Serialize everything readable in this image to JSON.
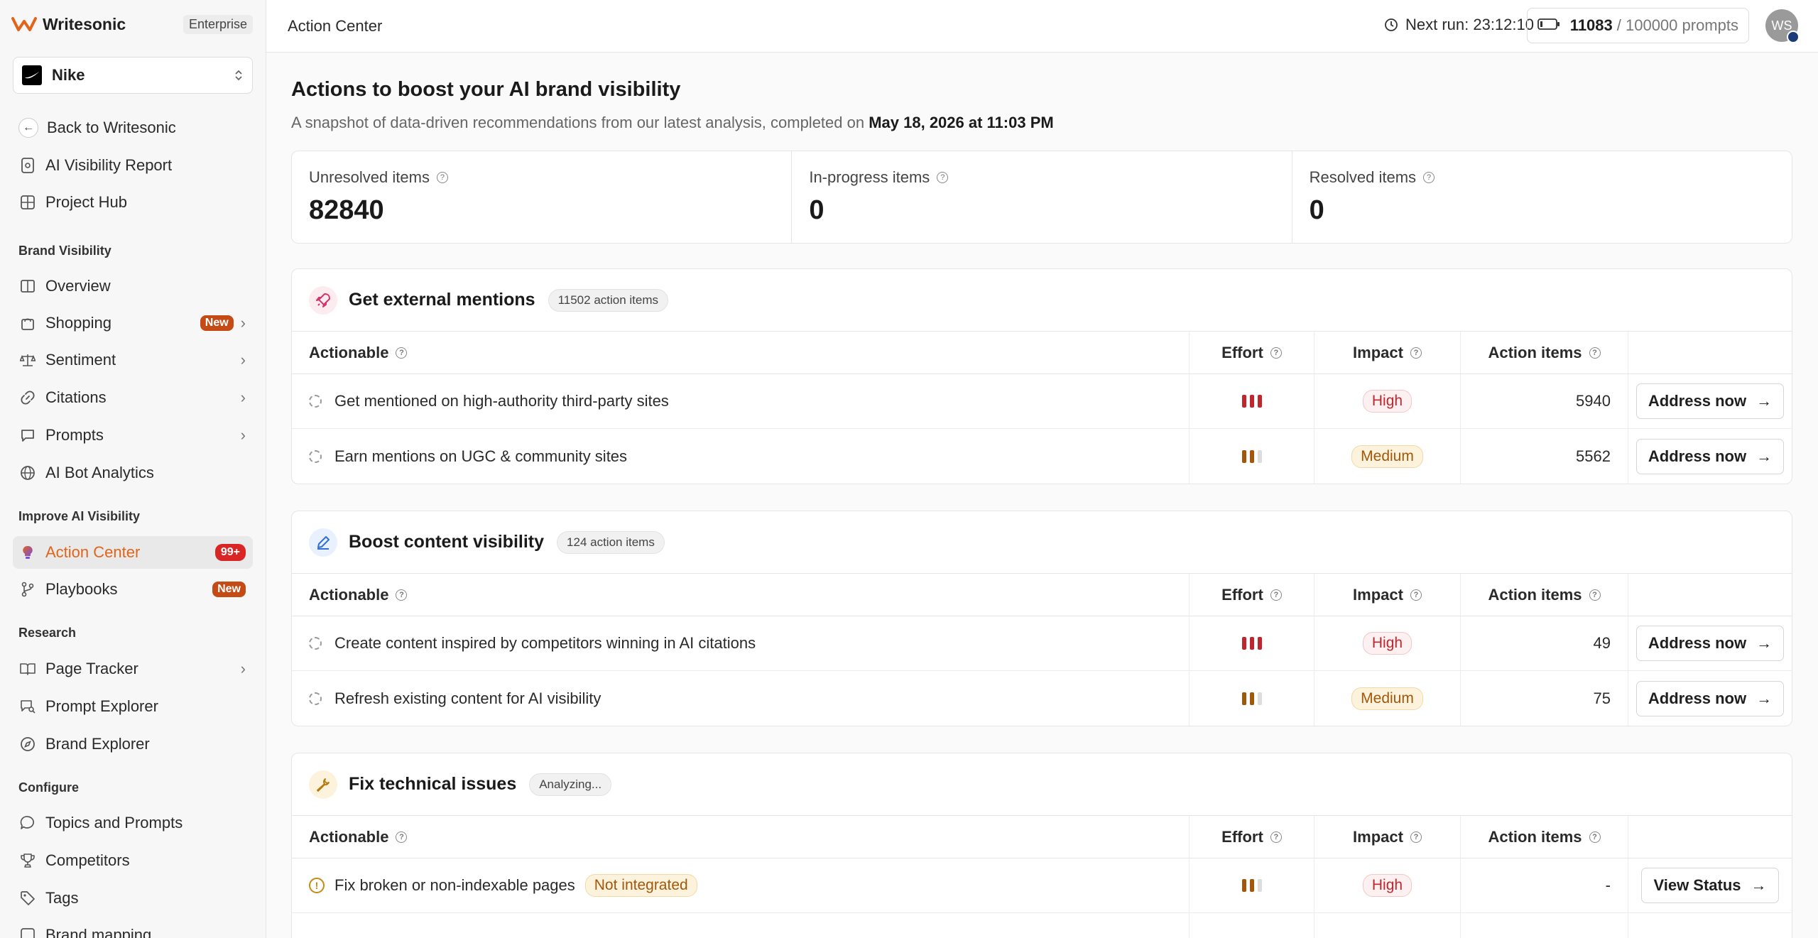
{
  "app": {
    "name": "Writesonic",
    "plan": "Enterprise"
  },
  "project": {
    "name": "Nike"
  },
  "sidebar": {
    "back": "Back to Writesonic",
    "top_items": [
      {
        "label": "AI Visibility Report",
        "icon": "report-icon"
      },
      {
        "label": "Project Hub",
        "icon": "grid-icon"
      }
    ],
    "sections": {
      "brand_visibility": "Brand Visibility",
      "improve": "Improve AI Visibility",
      "research": "Research",
      "configure": "Configure"
    },
    "brand_items": [
      {
        "label": "Overview"
      },
      {
        "label": "Shopping",
        "badge": "New"
      },
      {
        "label": "Sentiment"
      },
      {
        "label": "Citations"
      },
      {
        "label": "Prompts"
      },
      {
        "label": "AI Bot Analytics"
      }
    ],
    "improve_items": [
      {
        "label": "Action Center",
        "badge": "99+"
      },
      {
        "label": "Playbooks",
        "badge": "New"
      }
    ],
    "research_items": [
      {
        "label": "Page Tracker"
      },
      {
        "label": "Prompt Explorer"
      },
      {
        "label": "Brand Explorer"
      }
    ],
    "configure_items": [
      {
        "label": "Topics and Prompts"
      },
      {
        "label": "Competitors"
      },
      {
        "label": "Tags"
      },
      {
        "label": "Brand mapping"
      }
    ]
  },
  "topbar": {
    "breadcrumb": "Action Center",
    "next_run": "Next run: 23:12:10",
    "prompts_used": "11083",
    "prompts_total": "/ 100000 prompts",
    "avatar_initials": "WS"
  },
  "page": {
    "title": "Actions to boost your AI brand visibility",
    "subtitle": "A snapshot of data-driven recommendations from our latest analysis, completed on",
    "completed_on": "May 18, 2026 at 11:03 PM"
  },
  "stats": [
    {
      "label": "Unresolved items",
      "value": "82840"
    },
    {
      "label": "In-progress items",
      "value": "0"
    },
    {
      "label": "Resolved items",
      "value": "0"
    }
  ],
  "table_headers": {
    "actionable": "Actionable",
    "effort": "Effort",
    "impact": "Impact",
    "action_items": "Action items"
  },
  "colors": {
    "accent": "#e0651a",
    "high": "#c0262d",
    "medium": "#a2570a",
    "effort_high": "#c0262d",
    "effort_medium": "#a2570a"
  },
  "groups": [
    {
      "title": "Get external mentions",
      "badge": "11502 action items",
      "icon": "rocket-icon",
      "rows": [
        {
          "label": "Get mentioned on high-authority third-party sites",
          "effort": 3,
          "impact": "High",
          "count": "5940",
          "button": "Address now"
        },
        {
          "label": "Earn mentions on UGC & community sites",
          "effort": 2,
          "impact": "Medium",
          "count": "5562",
          "button": "Address now"
        }
      ]
    },
    {
      "title": "Boost content visibility",
      "badge": "124 action items",
      "icon": "pencil-icon",
      "rows": [
        {
          "label": "Create content inspired by competitors winning in AI citations",
          "effort": 3,
          "impact": "High",
          "count": "49",
          "button": "Address now"
        },
        {
          "label": "Refresh existing content for AI visibility",
          "effort": 2,
          "impact": "Medium",
          "count": "75",
          "button": "Address now"
        }
      ]
    },
    {
      "title": "Fix technical issues",
      "badge": "Analyzing...",
      "icon": "wrench-icon",
      "rows": [
        {
          "label": "Fix broken or non-indexable pages",
          "tag": "Not integrated",
          "effort": 2,
          "impact": "High",
          "count": "-",
          "button": "View Status"
        }
      ]
    }
  ]
}
